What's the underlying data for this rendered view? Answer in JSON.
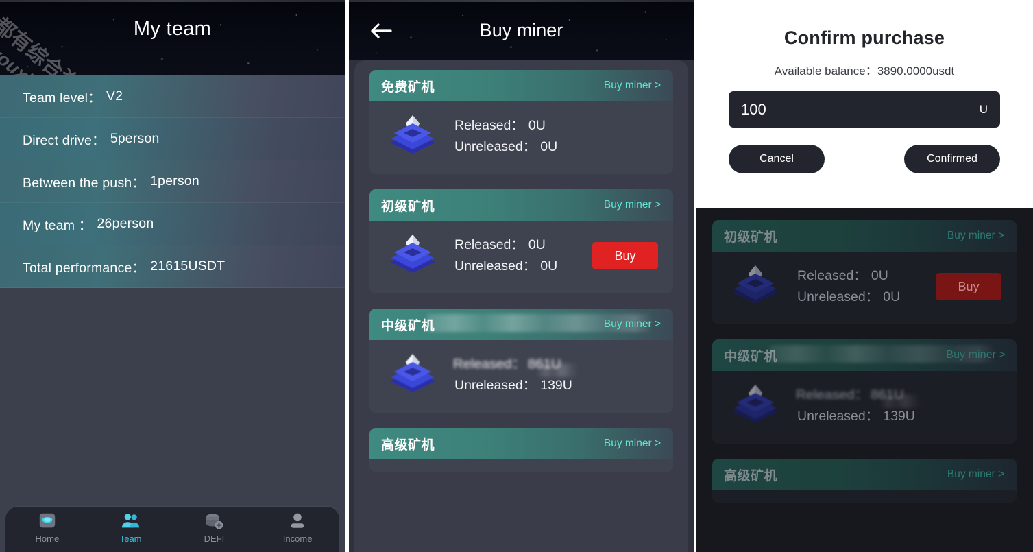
{
  "watermark": {
    "line1": "全都有综合资源网",
    "line2": "douyouxi.com"
  },
  "left_panel": {
    "title": "My team",
    "rows": [
      {
        "label": "Team level：",
        "value": "V2"
      },
      {
        "label": "Direct drive：",
        "value": "5person"
      },
      {
        "label": "Between the push：",
        "value": "1person"
      },
      {
        "label": "My team ：",
        "value": "26person"
      },
      {
        "label": "Total performance：",
        "value": "21615USDT"
      }
    ],
    "tabbar": [
      {
        "icon": "home-icon",
        "label": "Home",
        "active": false
      },
      {
        "icon": "team-icon",
        "label": "Team",
        "active": true
      },
      {
        "icon": "defi-icon",
        "label": "DEFI",
        "active": false
      },
      {
        "icon": "income-icon",
        "label": "Income",
        "active": false
      }
    ]
  },
  "mid_panel": {
    "title": "Buy miner",
    "back_icon": "back-arrow-icon",
    "cards": [
      {
        "title": "免费矿机",
        "link": "Buy miner >",
        "released_label": "Released：",
        "released_value": "0U",
        "unreleased_label": "Unreleased：",
        "unreleased_value": "0U",
        "buy_label": "",
        "has_buy": false,
        "blurred": false
      },
      {
        "title": "初级矿机",
        "link": "Buy miner >",
        "released_label": "Released：",
        "released_value": "0U",
        "unreleased_label": "Unreleased：",
        "unreleased_value": "0U",
        "buy_label": "Buy",
        "has_buy": true,
        "blurred": false
      },
      {
        "title": "中级矿机",
        "link": "Buy miner >",
        "released_label": "Released：",
        "released_value": "861U",
        "unreleased_label": "Unreleased：",
        "unreleased_value": "139U",
        "buy_label": "",
        "has_buy": false,
        "blurred": true
      },
      {
        "title": "高级矿机",
        "link": "Buy miner >",
        "released_label": "",
        "released_value": "",
        "unreleased_label": "",
        "unreleased_value": "",
        "buy_label": "",
        "has_buy": false,
        "blurred": false
      }
    ]
  },
  "right_panel": {
    "dialog": {
      "title": "Confirm purchase",
      "balance": "Available balance：3890.0000usdt",
      "amount_value": "100",
      "amount_placeholder": "100",
      "unit": "U",
      "cancel_label": "Cancel",
      "confirm_label": "Confirmed"
    },
    "cards": [
      {
        "title": "初级矿机",
        "link": "Buy miner >",
        "released_label": "Released：",
        "released_value": "0U",
        "unreleased_label": "Unreleased：",
        "unreleased_value": "0U",
        "buy_label": "Buy",
        "has_buy": true,
        "blurred": false
      },
      {
        "title": "中级矿机",
        "link": "Buy miner >",
        "released_label": "Released：",
        "released_value": "861U",
        "unreleased_label": "Unreleased：",
        "unreleased_value": "139U",
        "buy_label": "",
        "has_buy": false,
        "blurred": true
      },
      {
        "title": "高级矿机",
        "link": "Buy miner >",
        "released_label": "",
        "released_value": "",
        "unreleased_label": "",
        "unreleased_value": "",
        "buy_label": "",
        "has_buy": false,
        "blurred": false
      }
    ]
  },
  "colors": {
    "accent_teal": "#5fe6d4",
    "buy_red": "#e02222",
    "tab_active": "#39c3e0",
    "panel_bg": "#3c3f4c",
    "card_bg": "#3f4350"
  }
}
